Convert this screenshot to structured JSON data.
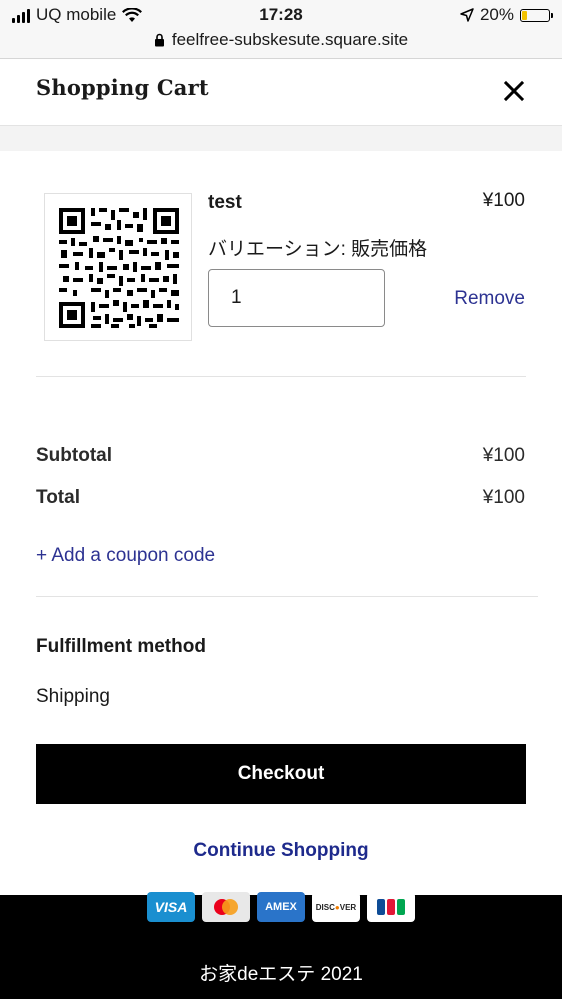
{
  "status_bar": {
    "carrier": "UQ mobile",
    "time": "17:28",
    "battery": "20%",
    "battery_level": 0.2,
    "url": "feelfree-subskesute.square.site"
  },
  "header": {
    "title": "Shopping Cart"
  },
  "item": {
    "name": "test",
    "price": "¥100",
    "variation": "バリエーション: 販売価格",
    "quantity": "1",
    "remove_label": "Remove"
  },
  "summary": {
    "subtotal_label": "Subtotal",
    "subtotal_value": "¥100",
    "total_label": "Total",
    "total_value": "¥100",
    "coupon_label": "+ Add a coupon code"
  },
  "fulfillment": {
    "title": "Fulfillment method",
    "value": "Shipping"
  },
  "actions": {
    "checkout_label": "Checkout",
    "continue_label": "Continue Shopping"
  },
  "footer": {
    "cards": [
      "VISA",
      "Mastercard",
      "AMEX",
      "DISCOVER",
      "JCB"
    ],
    "copyright": "お家deエステ 2021"
  },
  "colors": {
    "link": "#2d3392",
    "button": "#000000",
    "battery": "#f2c200"
  }
}
